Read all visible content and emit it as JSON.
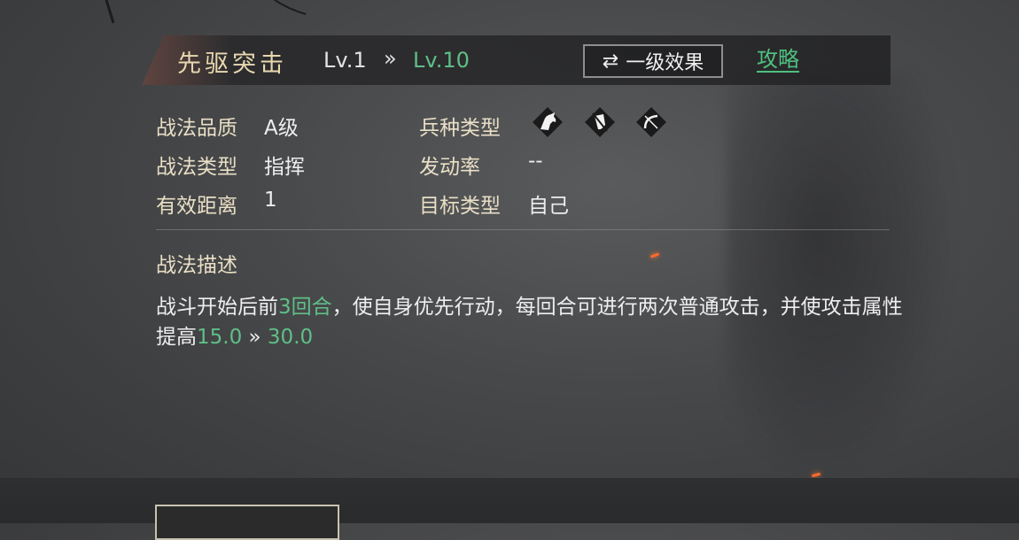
{
  "skill": {
    "name": "先驱突击",
    "level_from": "Lv.1",
    "level_arrow": "»",
    "level_to": "Lv.10"
  },
  "header": {
    "effect_button": "一级效果",
    "swap_icon": "swap-arrows-icon",
    "guide_link": "攻略"
  },
  "attributes": {
    "quality_label": "战法品质",
    "quality_value": "A级",
    "type_label": "战法类型",
    "type_value": "指挥",
    "range_label": "有效距离",
    "range_value": "1",
    "troop_label": "兵种类型",
    "troop_icons": [
      "cavalry-horse-icon",
      "shield-infantry-icon",
      "bow-archer-icon"
    ],
    "rate_label": "发动率",
    "rate_value": "--",
    "target_label": "目标类型",
    "target_value": "自己"
  },
  "description": {
    "title": "战法描述",
    "part1": "战斗开始后前",
    "highlight1": "3回合",
    "part2": "，使自身优先行动，每回合可进行两次普通攻击，并使攻击属性提高",
    "highlight2": "15.0",
    "arrow": " » ",
    "highlight3": "30.0"
  },
  "colors": {
    "accent_green": "#5fbf86",
    "label_gold": "#e9dfc6",
    "title_gold": "#e8d8b0"
  }
}
